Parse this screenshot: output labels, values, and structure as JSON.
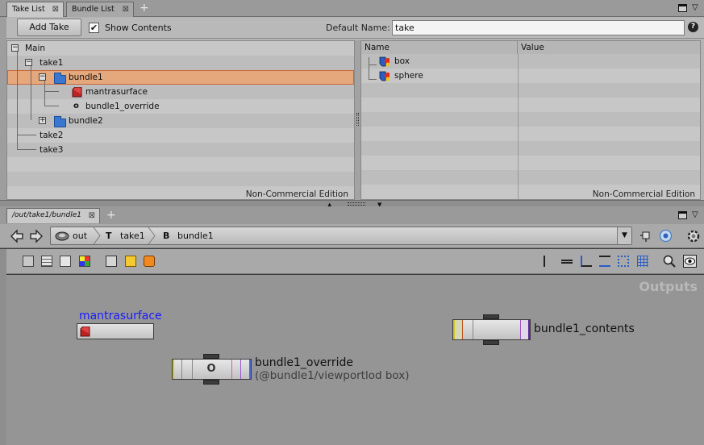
{
  "take_tabs": [
    {
      "label": "Take List",
      "active": true
    },
    {
      "label": "Bundle List",
      "active": false
    }
  ],
  "take_toolbar": {
    "add_take_label": "Add Take",
    "show_contents_label": "Show Contents",
    "show_contents_checked": true,
    "default_name_label": "Default Name:",
    "default_name_value": "take",
    "help_label": "?"
  },
  "tree": {
    "rows": [
      {
        "label": "Main"
      },
      {
        "label": "take1"
      },
      {
        "label": "bundle1"
      },
      {
        "label": "mantrasurface"
      },
      {
        "label": "bundle1_override"
      },
      {
        "label": "bundle2"
      },
      {
        "label": "take2"
      },
      {
        "label": "take3"
      }
    ],
    "footer": "Non-Commercial Edition"
  },
  "parm": {
    "col_name": "Name",
    "col_value": "Value",
    "rows": [
      {
        "name": "box",
        "value": ""
      },
      {
        "name": "sphere",
        "value": ""
      }
    ],
    "footer": "Non-Commercial Edition"
  },
  "net_tab": {
    "label": "/out/take1/bundle1"
  },
  "path": {
    "crumbs": [
      "out",
      "take1",
      "bundle1"
    ],
    "crumb_prefix": [
      "T",
      "B"
    ]
  },
  "network": {
    "outputs_label": "Outputs",
    "nodes": {
      "mantrasurface": {
        "name": "mantrasurface"
      },
      "bundle1_contents": {
        "name": "bundle1_contents"
      },
      "bundle1_override": {
        "name": "bundle1_override",
        "subtitle": "(@bundle1/viewportlod box)",
        "glyph": "O"
      }
    }
  },
  "colors": {
    "selection": "#e5a77c",
    "link_blue": "#1a1aff",
    "folder_blue": "#3a78d0"
  }
}
